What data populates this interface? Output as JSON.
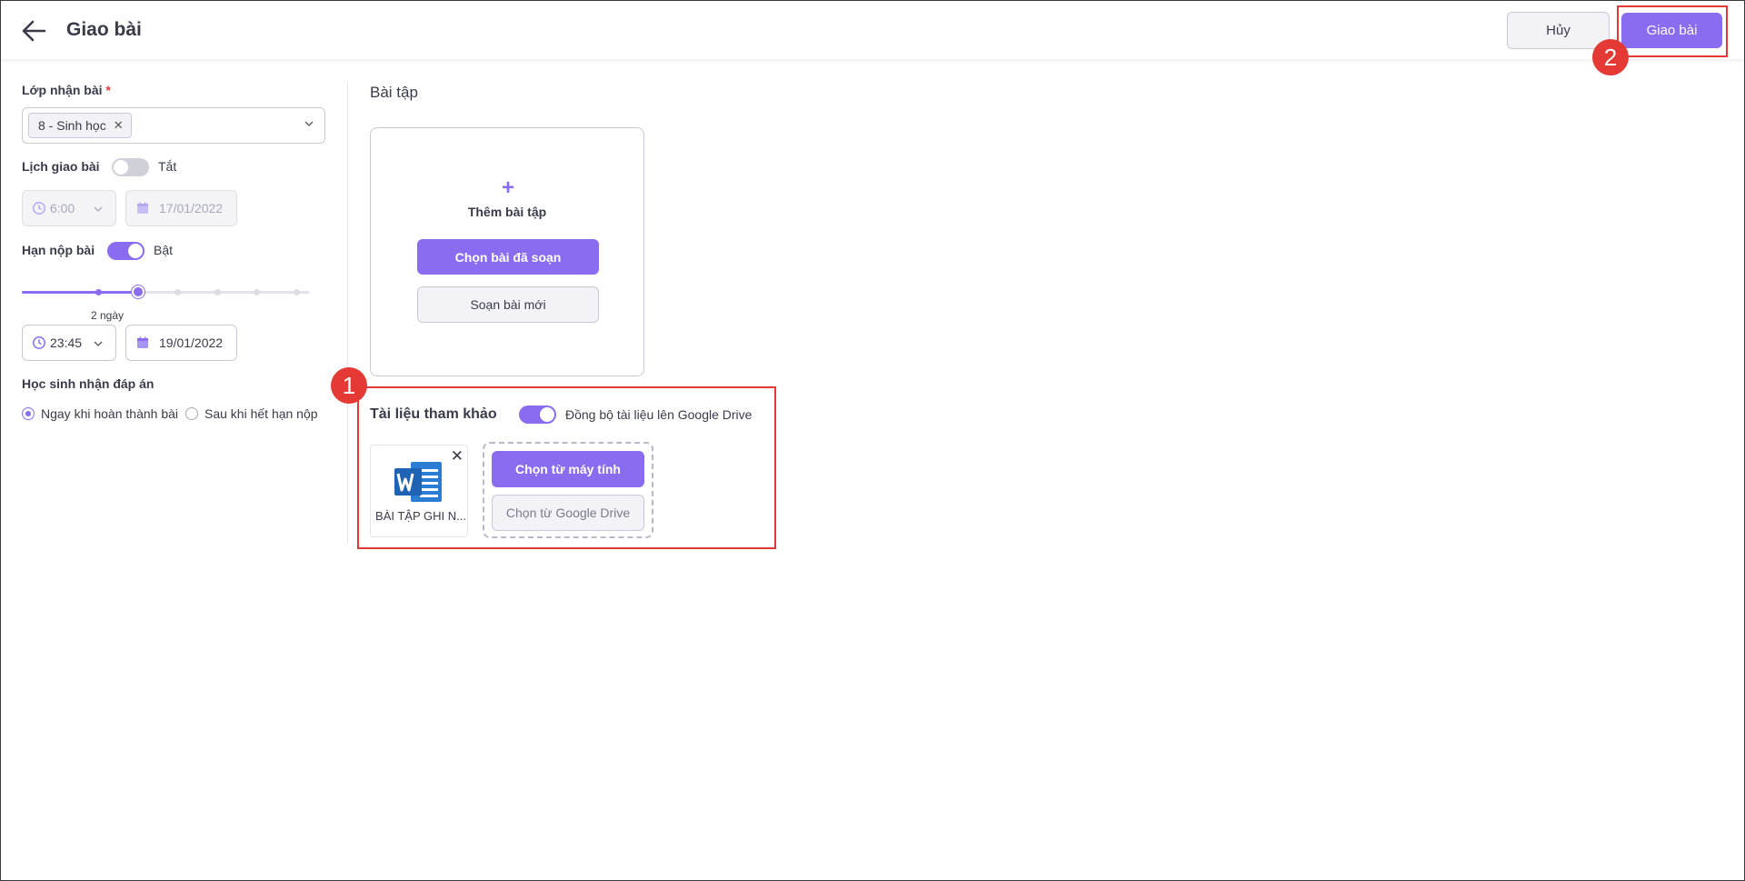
{
  "header": {
    "title": "Giao bài",
    "cancel_label": "Hủy",
    "submit_label": "Giao bài"
  },
  "annotations": {
    "badge_1": "1",
    "badge_2": "2",
    "highlight_color": "#e53935"
  },
  "left_panel": {
    "class_label": "Lớp nhận bài",
    "required_mark": "*",
    "selected_class": "8 - Sinh học",
    "schedule_label": "Lịch giao bài",
    "schedule_toggle_state": "Tắt",
    "schedule_time": "6:00",
    "schedule_date": "17/01/2022",
    "deadline_label": "Hạn nộp bài",
    "deadline_toggle_state": "Bật",
    "deadline_slider_label": "2 ngày",
    "deadline_slider_step": 2,
    "deadline_slider_steps_total": 7,
    "deadline_time": "23:45",
    "deadline_date": "19/01/2022",
    "answer_label": "Học sinh nhận đáp án",
    "answer_options": [
      {
        "label": "Ngay khi hoàn thành bài",
        "checked": true
      },
      {
        "label": "Sau khi hết hạn nộp",
        "checked": false
      }
    ]
  },
  "exercises": {
    "section_title": "Bài tập",
    "add_text": "Thêm bài tập",
    "choose_prepared_label": "Chọn bài đã soạn",
    "compose_new_label": "Soạn bài mới"
  },
  "references": {
    "title": "Tài liệu tham khảo",
    "sync_label": "Đồng bộ tài liệu lên Google Drive",
    "sync_on": true,
    "files": [
      {
        "name": "BÀI TẬP GHI N...",
        "icon": "word-doc-icon"
      }
    ],
    "from_computer_label": "Chọn từ máy tính",
    "from_drive_label": "Chọn từ Google Drive"
  },
  "colors": {
    "accent": "#8a6cf0",
    "border": "#c9c9d6",
    "word_blue": "#2b7cd3"
  }
}
